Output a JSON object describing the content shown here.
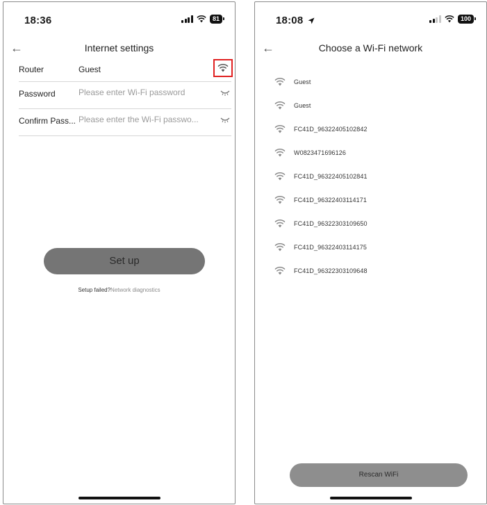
{
  "left_screen": {
    "status": {
      "time": "18:36",
      "battery": "81"
    },
    "title": "Internet settings",
    "router": {
      "label": "Router",
      "value": "Guest"
    },
    "password": {
      "label": "Password",
      "placeholder": "Please enter Wi-Fi password"
    },
    "confirm": {
      "label": "Confirm Pass...",
      "placeholder": "Please enter the Wi-Fi passwo..."
    },
    "setup_button": "Set up",
    "help": {
      "text": "Setup failed?",
      "link": "Network diagnostics"
    }
  },
  "right_screen": {
    "status": {
      "time": "18:08",
      "battery": "100"
    },
    "title": "Choose a Wi-Fi network",
    "networks": [
      {
        "name": "Guest"
      },
      {
        "name": "Guest"
      },
      {
        "name": "FC41D_96322405102842"
      },
      {
        "name": "W0823471696126"
      },
      {
        "name": "FC41D_96322405102841"
      },
      {
        "name": "FC41D_96322403114171"
      },
      {
        "name": "FC41D_96322303109650"
      },
      {
        "name": "FC41D_96322403114175"
      },
      {
        "name": "FC41D_96322303109648"
      }
    ],
    "rescan_button": "Rescan WiFi"
  },
  "colors": {
    "highlight": "#e02020",
    "button": "#757575",
    "placeholder": "#9a9a9a",
    "divider": "#d6d6d6"
  },
  "icons": [
    "back-arrow-icon",
    "wifi-icon",
    "eye-closed-icon",
    "signal-icon",
    "location-arrow-icon",
    "battery-icon"
  ]
}
